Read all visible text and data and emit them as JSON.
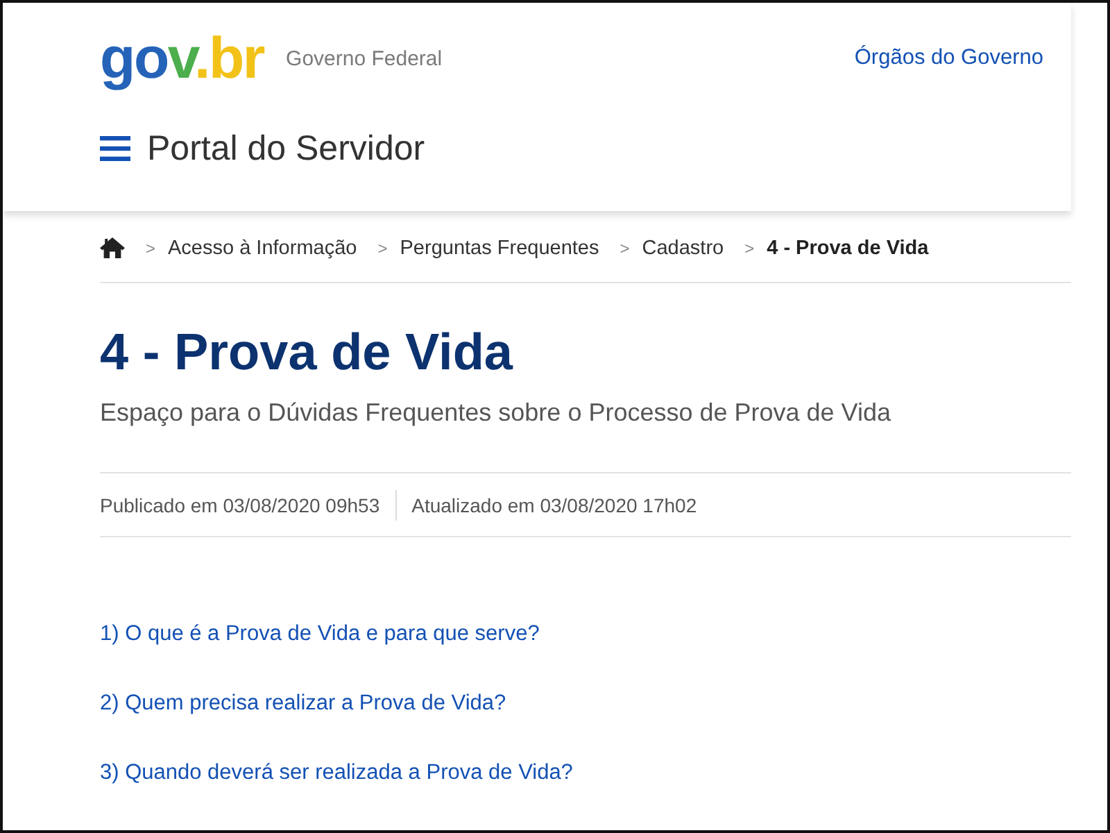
{
  "header": {
    "logo": {
      "parts": [
        {
          "text": "go",
          "color": "#2563b8"
        },
        {
          "text": "v",
          "color": "#4cae4c"
        },
        {
          "text": ".br",
          "color": "#f2c218"
        }
      ]
    },
    "tagline": "Governo Federal",
    "link": "Órgãos do Governo",
    "site_title": "Portal do Servidor"
  },
  "breadcrumb": [
    {
      "separator": ">",
      "label": "Acesso à Informação",
      "current": false
    },
    {
      "separator": ">",
      "label": "Perguntas Frequentes",
      "current": false
    },
    {
      "separator": ">",
      "label": "Cadastro",
      "current": false
    },
    {
      "separator": ">",
      "label": "4 - Prova de Vida",
      "current": true
    }
  ],
  "page": {
    "title": "4 - Prova de Vida",
    "description": "Espaço para o Dúvidas Frequentes sobre o Processo de Prova de Vida",
    "published": "Publicado em 03/08/2020 09h53",
    "updated": "Atualizado em 03/08/2020 17h02"
  },
  "questions": [
    "1) O que é a Prova de Vida e para que serve?",
    "2) Quem precisa realizar a Prova de Vida?",
    "3) Quando deverá ser realizada a Prova de Vida?"
  ]
}
